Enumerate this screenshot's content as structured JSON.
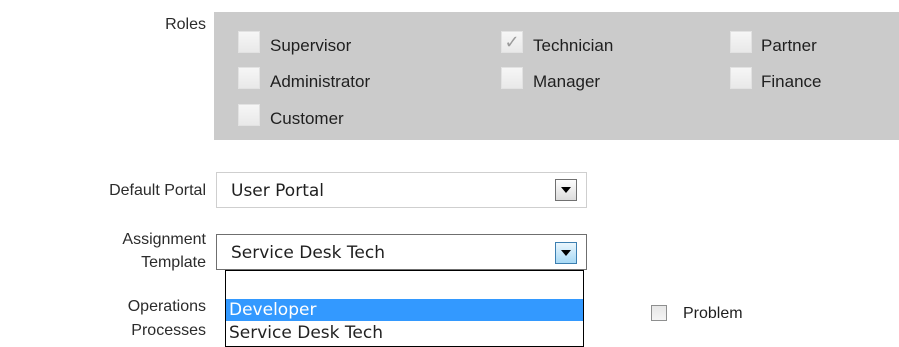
{
  "roles": {
    "label": "Roles",
    "items": [
      {
        "label": "Supervisor",
        "checked": false
      },
      {
        "label": "Technician",
        "checked": true
      },
      {
        "label": "Partner",
        "checked": false
      },
      {
        "label": "Administrator",
        "checked": false
      },
      {
        "label": "Manager",
        "checked": false
      },
      {
        "label": "Finance",
        "checked": false
      },
      {
        "label": "Customer",
        "checked": false
      }
    ]
  },
  "default_portal": {
    "label": "Default Portal",
    "value": "User Portal"
  },
  "assignment_template": {
    "label_line1": "Assignment",
    "label_line2": "Template",
    "value": "Service Desk Tech",
    "options": [
      "",
      "Developer",
      "Service Desk Tech"
    ]
  },
  "operations_processes": {
    "label_line1": "Operations",
    "label_line2": "Processes",
    "items": [
      {
        "label": "Problem",
        "checked": false
      }
    ]
  },
  "icons": {
    "check": "✓",
    "dropdown_arrow": "chevron-down-icon"
  }
}
